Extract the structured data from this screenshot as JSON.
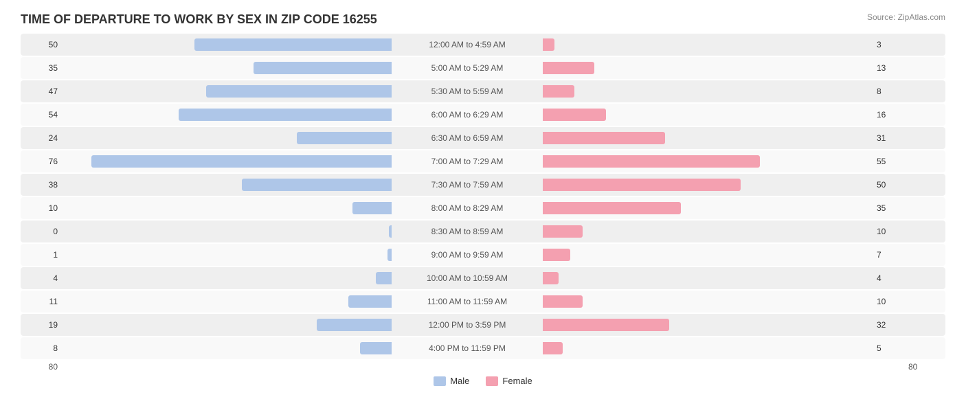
{
  "title": "TIME OF DEPARTURE TO WORK BY SEX IN ZIP CODE 16255",
  "source": "Source: ZipAtlas.com",
  "maxValue": 80,
  "legend": {
    "male": "Male",
    "female": "Female"
  },
  "rows": [
    {
      "label": "12:00 AM to 4:59 AM",
      "male": 50,
      "female": 3
    },
    {
      "label": "5:00 AM to 5:29 AM",
      "male": 35,
      "female": 13
    },
    {
      "label": "5:30 AM to 5:59 AM",
      "male": 47,
      "female": 8
    },
    {
      "label": "6:00 AM to 6:29 AM",
      "male": 54,
      "female": 16
    },
    {
      "label": "6:30 AM to 6:59 AM",
      "male": 24,
      "female": 31
    },
    {
      "label": "7:00 AM to 7:29 AM",
      "male": 76,
      "female": 55
    },
    {
      "label": "7:30 AM to 7:59 AM",
      "male": 38,
      "female": 50
    },
    {
      "label": "8:00 AM to 8:29 AM",
      "male": 10,
      "female": 35
    },
    {
      "label": "8:30 AM to 8:59 AM",
      "male": 0,
      "female": 10
    },
    {
      "label": "9:00 AM to 9:59 AM",
      "male": 1,
      "female": 7
    },
    {
      "label": "10:00 AM to 10:59 AM",
      "male": 4,
      "female": 4
    },
    {
      "label": "11:00 AM to 11:59 AM",
      "male": 11,
      "female": 10
    },
    {
      "label": "12:00 PM to 3:59 PM",
      "male": 19,
      "female": 32
    },
    {
      "label": "4:00 PM to 11:59 PM",
      "male": 8,
      "female": 5
    }
  ]
}
